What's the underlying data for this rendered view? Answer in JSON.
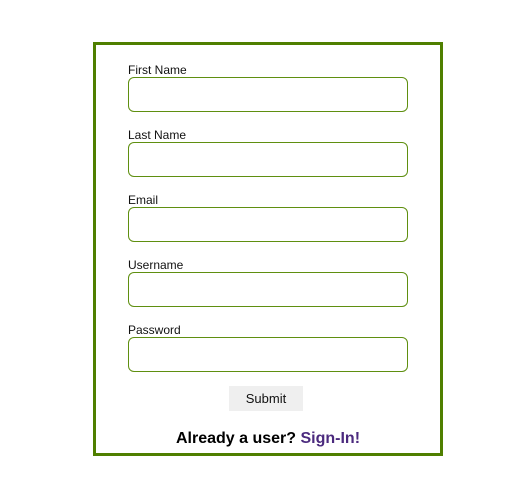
{
  "form": {
    "fields": [
      {
        "label": "First Name",
        "value": "",
        "placeholder": ""
      },
      {
        "label": "Last Name",
        "value": "",
        "placeholder": ""
      },
      {
        "label": "Email",
        "value": "",
        "placeholder": ""
      },
      {
        "label": "Username",
        "value": "",
        "placeholder": ""
      },
      {
        "label": "Password",
        "value": "",
        "placeholder": ""
      }
    ],
    "submit_label": "Submit",
    "signin_prompt": "Already a user?",
    "signin_link_label": "Sign-In!"
  },
  "colors": {
    "border_accent": "#4f7f00",
    "link": "#4b2a7e",
    "button_bg": "#efefef"
  }
}
